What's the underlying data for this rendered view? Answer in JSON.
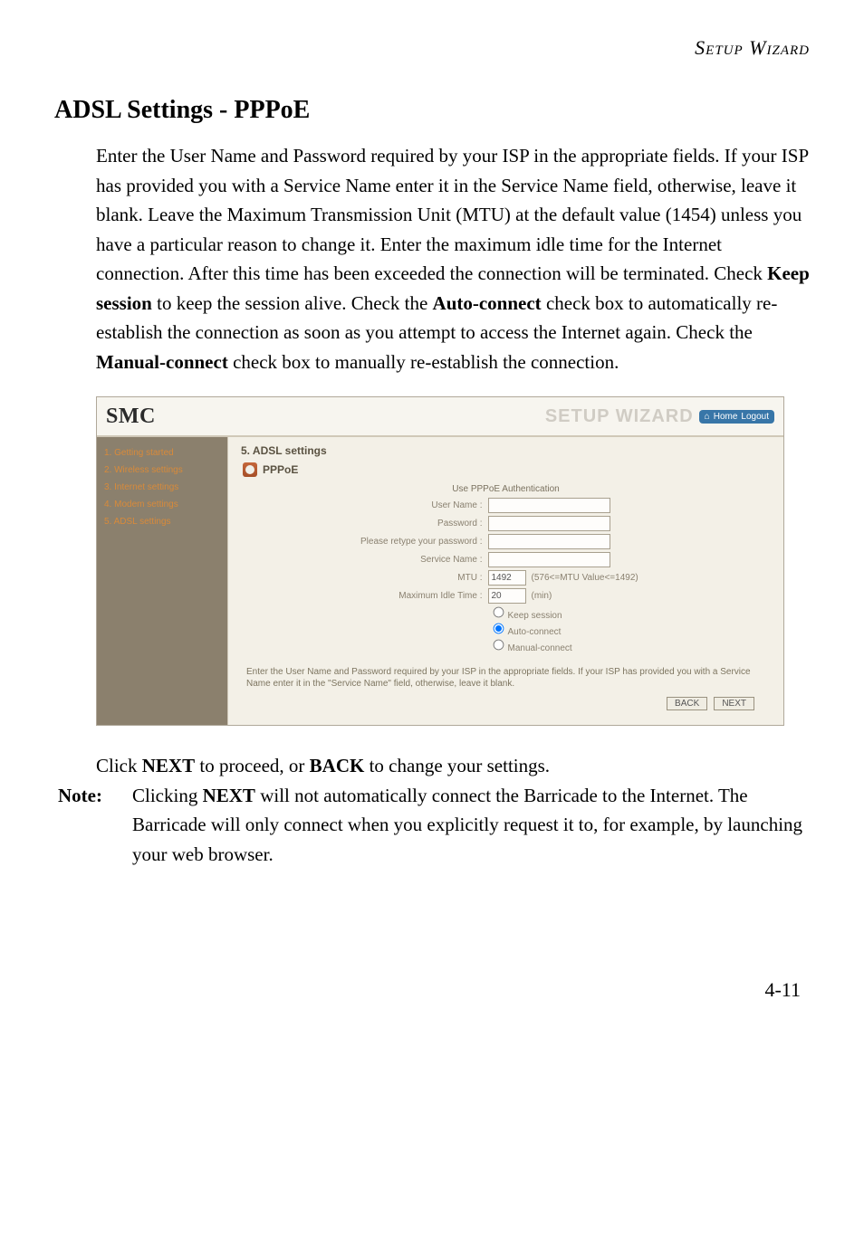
{
  "header": {
    "right": "Setup Wizard"
  },
  "title": "ADSL Settings - PPPoE",
  "paragraph_html": "Enter the User Name and Password required by your ISP in the appropriate fields. If your ISP has provided you with a Service Name enter it in the Service Name field, otherwise, leave it blank. Leave the Maximum Transmission Unit (MTU) at the default value (1454) unless you have a particular reason to change it. Enter the maximum idle time for the Internet connection. After this time has been exceeded the connection will be terminated. Check <strong>Keep session</strong> to keep the session alive. Check the <strong>Auto-connect</strong> check box to automatically re-establish the connection as soon as you attempt to access the Internet again. Check the <strong>Manual-connect</strong> check box to manually re-establish the connection.",
  "screenshot": {
    "logo": "SMC",
    "wizard": "SETUP WIZARD",
    "chip_home": "Home",
    "chip_logout": "Logout",
    "sidebar": [
      "1. Getting started",
      "2. Wireless settings",
      "3. Internet settings",
      "4. Modem settings",
      "5. ADSL settings"
    ],
    "step_title": "5. ADSL settings",
    "subtitle": "PPPoE",
    "form_header": "Use PPPoE Authentication",
    "labels": {
      "user": "User Name :",
      "pass": "Password :",
      "retype": "Please retype your password :",
      "service": "Service Name :",
      "mtu": "MTU :",
      "idle": "Maximum Idle Time :"
    },
    "values": {
      "mtu": "1492",
      "idle": "20"
    },
    "hints": {
      "mtu": "(576<=MTU Value<=1492)",
      "idle": "(min)"
    },
    "radios": {
      "keep": "Keep session",
      "auto": "Auto-connect",
      "manual": "Manual-connect"
    },
    "instruction": "Enter the User Name and Password required by your ISP in the appropriate fields. If your ISP has provided you with a Service Name enter it in the \"Service Name\" field, otherwise, leave it blank.",
    "buttons": {
      "back": "BACK",
      "next": "NEXT"
    }
  },
  "post_line_html": "Click <strong>NEXT</strong> to proceed, or <strong>BACK</strong> to change your settings.",
  "note": {
    "label": "Note:",
    "body_html": "Clicking <strong>NEXT</strong> will not automatically connect the Barricade to the Internet. The Barricade will only connect when you explicitly request it to, for example, by launching your web browser."
  },
  "page_number": "4-11"
}
